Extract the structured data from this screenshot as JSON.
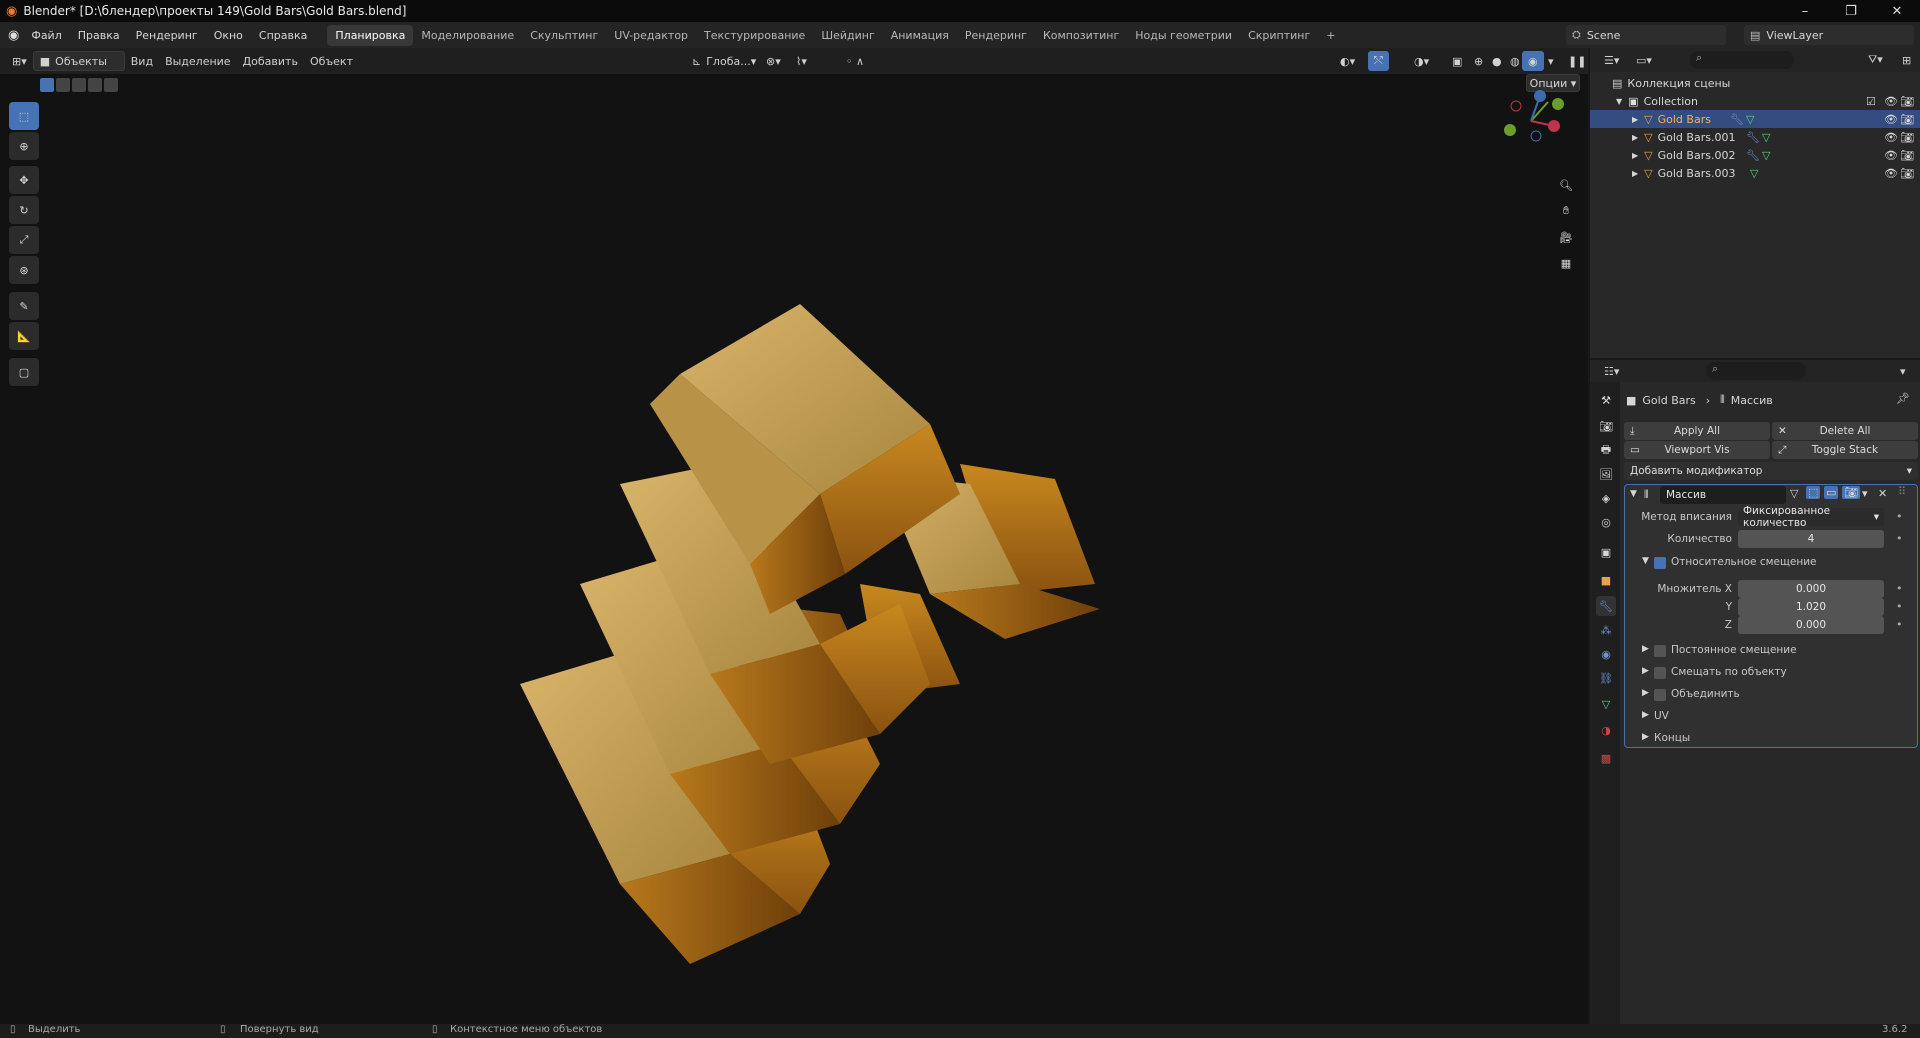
{
  "window": {
    "title": "Blender* [D:\\блендер\\проекты 149\\Gold Bars\\Gold Bars.blend]"
  },
  "menu": {
    "file": "Файл",
    "edit": "Правка",
    "render": "Рендеринг",
    "window": "Окно",
    "help": "Справка"
  },
  "workspaces": [
    "Планировка",
    "Моделирование",
    "Скульптинг",
    "UV-редактор",
    "Текстурирование",
    "Шейдинг",
    "Анимация",
    "Рендеринг",
    "Композитинг",
    "Ноды геометрии",
    "Скриптинг"
  ],
  "workspace_add": "+",
  "scene": {
    "name": "Scene",
    "view_layer": "ViewLayer"
  },
  "viewport_header": {
    "mode": "Объекты",
    "view": "Вид",
    "select": "Выделение",
    "add": "Добавить",
    "object": "Объект",
    "transform": "Глоба...",
    "options": "Опции"
  },
  "outliner": {
    "root": "Коллекция сцены",
    "collection": "Collection",
    "items": [
      {
        "name": "Gold Bars",
        "selected": true,
        "has_modifier": true
      },
      {
        "name": "Gold Bars.001",
        "selected": false,
        "has_modifier": true
      },
      {
        "name": "Gold Bars.002",
        "selected": false,
        "has_modifier": true
      },
      {
        "name": "Gold Bars.003",
        "selected": false,
        "has_modifier": false
      }
    ]
  },
  "properties": {
    "breadcrumb_object": "Gold Bars",
    "breadcrumb_modifier": "Массив",
    "apply_all": "Apply All",
    "delete_all": "Delete All",
    "viewport_vis": "Viewport Vis",
    "toggle_stack": "Toggle Stack",
    "add_modifier": "Добавить модификатор",
    "modifier_name": "Массив",
    "fit_type_label": "Метод вписания",
    "fit_type_value": "Фиксированное количество",
    "count_label": "Количество",
    "count_value": "4",
    "relative_offset": "Относительное смещение",
    "factor_x_label": "Множитель X",
    "factor_x": "0.000",
    "y_label": "Y",
    "factor_y": "1.020",
    "z_label": "Z",
    "factor_z": "0.000",
    "constant_offset": "Постоянное смещение",
    "object_offset": "Смещать по объекту",
    "merge": "Объединить",
    "uv": "UV",
    "caps": "Концы"
  },
  "status": {
    "select": "Выделить",
    "rotate": "Повернуть вид",
    "context": "Контекстное меню объектов",
    "version": "3.6.2"
  },
  "colors": {
    "accent": "#4772b3",
    "selected_row": "#334d80",
    "gold": "#c48a2a",
    "object_orange": "#e8a24a",
    "mesh_green": "#5fcf80"
  }
}
